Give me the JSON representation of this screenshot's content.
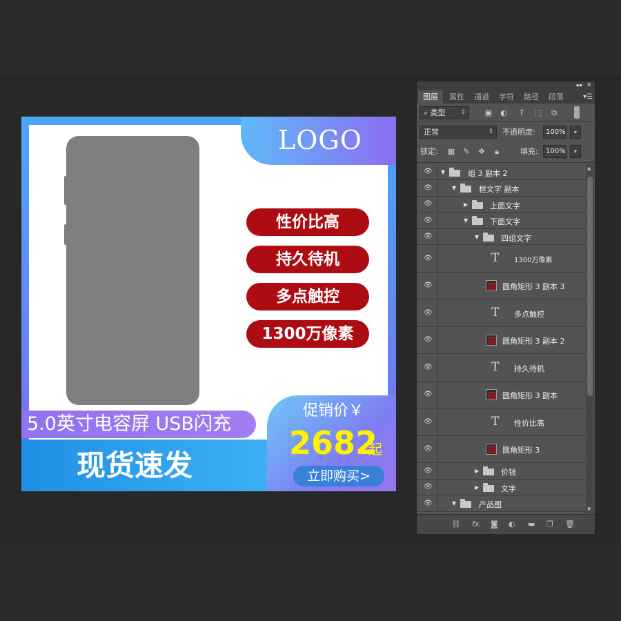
{
  "canvas": {
    "logo": "LOGO",
    "features": [
      "性价比高",
      "持久待机",
      "多点触控",
      "1300万像素"
    ],
    "spec_line": "5.0英寸电容屏  USB闪充",
    "bottom_slogan": "现货速发",
    "promo_label": "促销价￥",
    "price": "2682",
    "price_suffix": "起",
    "buy_button": "立即购买>",
    "colors": {
      "feature_pill": "#ad0d12",
      "price": "#fff200",
      "gradient_start": "#4aa8f5",
      "gradient_end": "#7b6cf0"
    }
  },
  "layers_panel": {
    "tabs": [
      "图层",
      "属性",
      "通道",
      "字符",
      "路径",
      "段落"
    ],
    "filter_label": "类型",
    "blend_mode": "正常",
    "opacity_label": "不透明度:",
    "opacity_value": "100%",
    "lock_label": "锁定:",
    "fill_label": "填充:",
    "fill_value": "100%",
    "layers": [
      {
        "name": "组 3 副本 2",
        "kind": "group",
        "expanded": true
      },
      {
        "name": "框文字 副本",
        "kind": "group",
        "expanded": true
      },
      {
        "name": "上面文字",
        "kind": "group",
        "expanded": false
      },
      {
        "name": "下面文字",
        "kind": "group",
        "expanded": true
      },
      {
        "name": "四组文字",
        "kind": "group",
        "expanded": true
      },
      {
        "name": "1300万像素",
        "kind": "text"
      },
      {
        "name": "圆角矩形 3 副本 3",
        "kind": "shape"
      },
      {
        "name": "多点触控",
        "kind": "text"
      },
      {
        "name": "圆角矩形 3 副本 2",
        "kind": "shape"
      },
      {
        "name": "持久待机",
        "kind": "text"
      },
      {
        "name": "圆角矩形 3 副本",
        "kind": "shape"
      },
      {
        "name": "性价比高",
        "kind": "text"
      },
      {
        "name": "圆角矩形 3",
        "kind": "shape"
      },
      {
        "name": "价钱",
        "kind": "group",
        "expanded": false
      },
      {
        "name": "文字",
        "kind": "group",
        "expanded": false
      },
      {
        "name": "产品图",
        "kind": "group",
        "expanded": true
      }
    ]
  }
}
